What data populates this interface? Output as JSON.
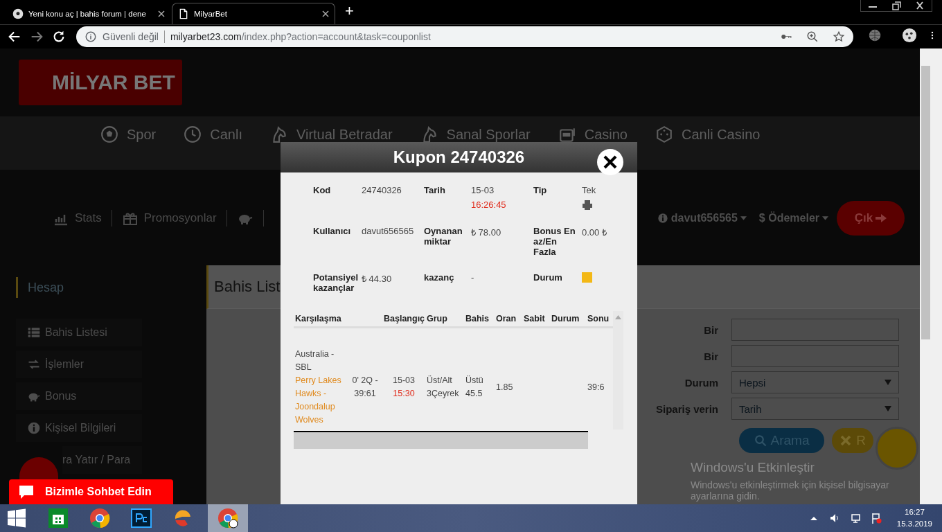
{
  "browser": {
    "tabs": [
      {
        "title": "Yeni konu aç | bahis forum | dene",
        "selected": false
      },
      {
        "title": "MilyarBet",
        "selected": true
      }
    ],
    "new_tab": "+",
    "security": "Güvenli değil",
    "url_host": "milyarbet23.com",
    "url_path": "/index.php?action=account&task=couponlist"
  },
  "site": {
    "logo": "MİLYAR BET",
    "main_nav": [
      {
        "label": "Spor"
      },
      {
        "label": "Canlı"
      },
      {
        "label": "Virtual Betradar"
      },
      {
        "label": "Sanal Sporlar"
      },
      {
        "label": "Casino"
      },
      {
        "label": "Canli Casino"
      }
    ],
    "secondary_nav": [
      {
        "label": "Stats"
      },
      {
        "label": "Promosyonlar"
      }
    ],
    "user_menu": "davut656565",
    "payments_menu": "$ Ödemeler",
    "logout": "Çık"
  },
  "sidebar": {
    "title": "Hesap",
    "items": [
      {
        "label": "Bahis Listesi"
      },
      {
        "label": "İşlemler"
      },
      {
        "label": "Bonus"
      },
      {
        "label": "Kişisel Bilgileri"
      },
      {
        "label": "ra Yatır / Para"
      }
    ]
  },
  "panel": {
    "title": "Bahis List",
    "filters": [
      {
        "kind": "text",
        "label": "Bir"
      },
      {
        "kind": "text",
        "label": "Bir"
      },
      {
        "kind": "select",
        "label": "Durum",
        "value": "Hepsi"
      },
      {
        "kind": "select",
        "label": "Sipariş verin",
        "value": "Tarih"
      }
    ],
    "buttons": [
      {
        "kind": "search",
        "label": "Arama"
      },
      {
        "kind": "reset",
        "label": "R"
      }
    ]
  },
  "chat_banner": "Bizimle Sohbet Edin",
  "coupon_modal": {
    "title": "Kupon 24740326",
    "info_rows": [
      [
        {
          "kind": "text",
          "label": "Kod",
          "value": "24740326"
        },
        {
          "kind": "datetime",
          "label": "Tarih",
          "value": "15-03",
          "time": "16:26:45"
        },
        {
          "kind": "printable",
          "label": "Tip",
          "value": "Tek"
        }
      ],
      [
        {
          "kind": "text",
          "label": "Kullanıcı",
          "value": "davut656565"
        },
        {
          "kind": "text",
          "label": "Oynanan miktar",
          "value": "₺ 78.00"
        },
        {
          "kind": "text",
          "label": "Bonus En az/En Fazla",
          "value": "0.00 ₺"
        }
      ],
      [
        {
          "kind": "text",
          "label": "Potansiyel kazançlar",
          "value": "₺ 44.30"
        },
        {
          "kind": "text",
          "label": "kazanç",
          "value": "-"
        },
        {
          "kind": "status",
          "label": "Durum"
        }
      ]
    ],
    "table": {
      "columns": [
        "Karşılaşma",
        "Başlangıç",
        "Grup",
        "Bahis",
        "Oran",
        "Sabit",
        "Durum",
        "Sonu"
      ],
      "rows": [
        {
          "league": "Australia - SBL",
          "teams": "Perry Lakes Hawks - Joondalup Wolves",
          "live_score": "0' 2Q - 39:61",
          "start_date": "15-03",
          "start_time": "15:30",
          "group": "Üst/Alt 3Çeyrek",
          "bet": "Üstü 45.5",
          "odds": "1.85",
          "result": "39:6"
        }
      ]
    }
  },
  "activation_notice": {
    "title": "Windows'u Etkinleştir",
    "text": "Windows'u etkinleştirmek için kişisel bilgisayar ayarlarına gidin."
  },
  "taskbar": {
    "time": "16:27",
    "date": "15.3.2019"
  }
}
